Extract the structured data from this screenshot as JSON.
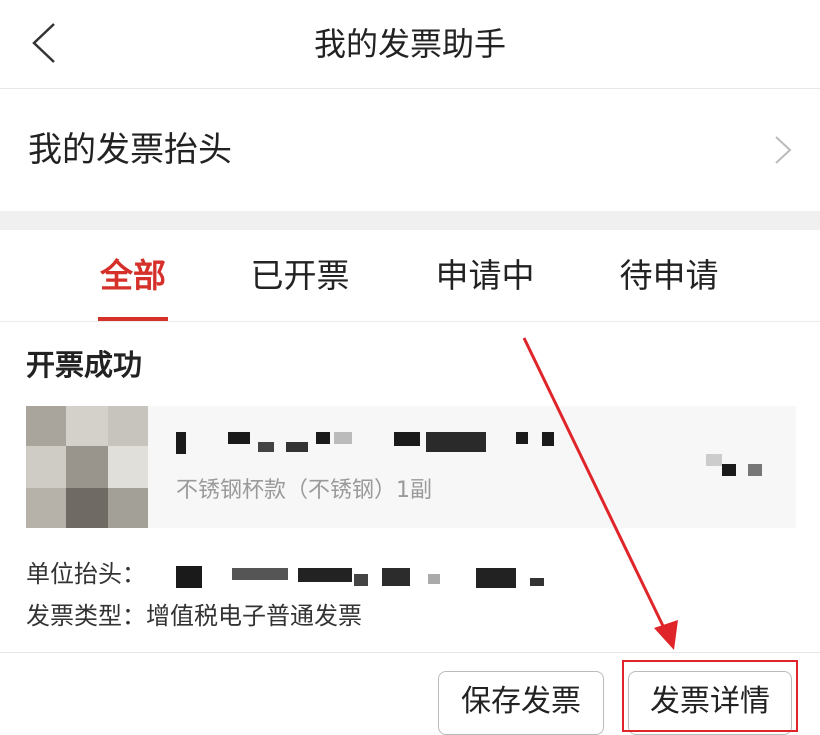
{
  "nav": {
    "title": "我的发票助手",
    "back_icon": "chevron-left-icon"
  },
  "invoice_header": {
    "label": "我的发票抬头",
    "chevron_icon": "chevron-right-icon"
  },
  "tabs": [
    {
      "label": "全部",
      "active": true
    },
    {
      "label": "已开票",
      "active": false
    },
    {
      "label": "申请中",
      "active": false
    },
    {
      "label": "待申请",
      "active": false
    }
  ],
  "order": {
    "status": "开票成功",
    "product_desc": "不锈钢杯款（不锈钢）1副",
    "info": [
      {
        "label": "单位抬头：",
        "value": ""
      },
      {
        "label": "发票类型：",
        "value": "增值税电子普通发票"
      }
    ]
  },
  "footer": {
    "save_label": "保存发票",
    "detail_label": "发票详情"
  },
  "colors": {
    "accent": "#d6302a",
    "annotation": "#e0252a"
  }
}
